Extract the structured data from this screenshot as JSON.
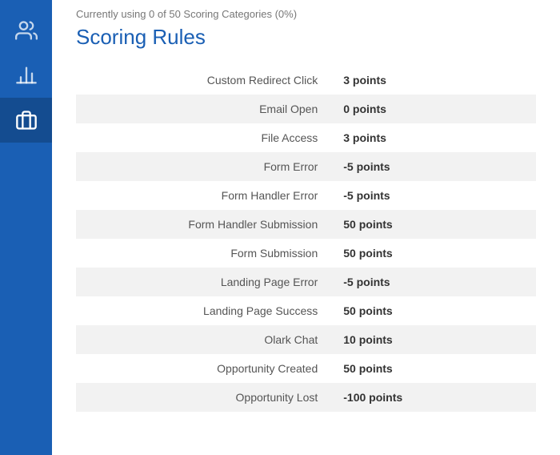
{
  "sidebar": {
    "items": [
      {
        "id": "users",
        "icon": "users",
        "active": false
      },
      {
        "id": "analytics",
        "icon": "bar-chart",
        "active": false
      },
      {
        "id": "briefcase",
        "icon": "briefcase",
        "active": true
      }
    ]
  },
  "header": {
    "notice": "Currently using 0 of 50 Scoring Categories (0%)",
    "title": "Scoring Rules"
  },
  "scoring_rules": [
    {
      "label": "Custom Redirect Click",
      "value": "3 points",
      "negative": false
    },
    {
      "label": "Email Open",
      "value": "0 points",
      "negative": false
    },
    {
      "label": "File Access",
      "value": "3 points",
      "negative": false
    },
    {
      "label": "Form Error",
      "value": "-5 points",
      "negative": true
    },
    {
      "label": "Form Handler Error",
      "value": "-5 points",
      "negative": true
    },
    {
      "label": "Form Handler Submission",
      "value": "50 points",
      "negative": false
    },
    {
      "label": "Form Submission",
      "value": "50 points",
      "negative": false
    },
    {
      "label": "Landing Page Error",
      "value": "-5 points",
      "negative": true
    },
    {
      "label": "Landing Page Success",
      "value": "50 points",
      "negative": false
    },
    {
      "label": "Olark Chat",
      "value": "10 points",
      "negative": false
    },
    {
      "label": "Opportunity Created",
      "value": "50 points",
      "negative": false
    },
    {
      "label": "Opportunity Lost",
      "value": "-100 points",
      "negative": true
    }
  ]
}
